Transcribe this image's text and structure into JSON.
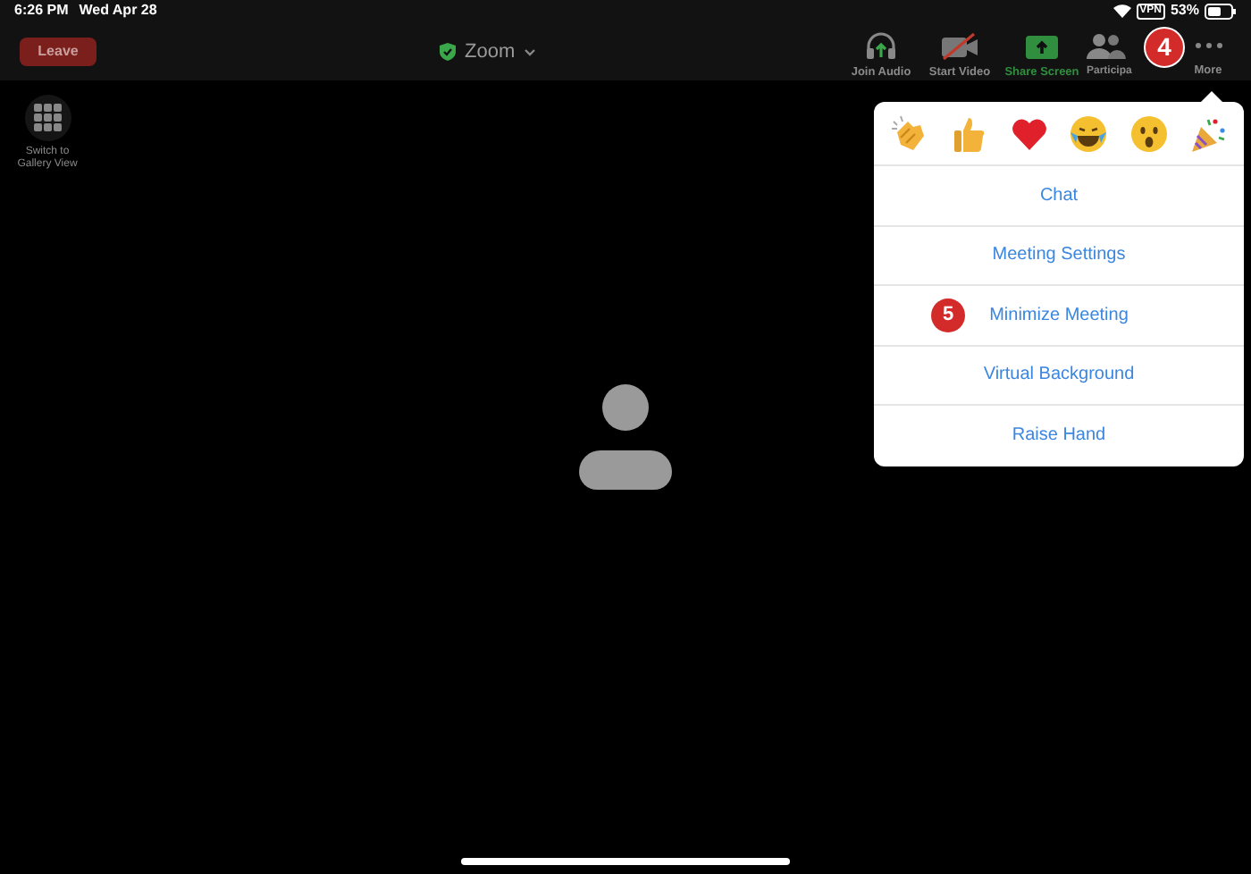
{
  "status_bar": {
    "time": "6:26 PM",
    "date": "Wed Apr 28",
    "vpn": "VPN",
    "battery": "53%"
  },
  "toolbar": {
    "leave": "Leave",
    "title": "Zoom",
    "buttons": [
      {
        "kind": "audio",
        "label": "Join Audio"
      },
      {
        "kind": "video",
        "label": "Start Video"
      },
      {
        "kind": "share",
        "label": "Share Screen"
      },
      {
        "kind": "participants",
        "label": "Participa"
      },
      {
        "kind": "more",
        "label": "More"
      }
    ]
  },
  "gallery_button": {
    "label": "Switch to Gallery View"
  },
  "toolbar_callout": "4",
  "menu": {
    "reactions": [
      {
        "kind": "clap"
      },
      {
        "kind": "thumbs"
      },
      {
        "kind": "heart"
      },
      {
        "kind": "laugh"
      },
      {
        "kind": "wow"
      },
      {
        "kind": "party"
      }
    ],
    "items": [
      {
        "label": "Chat"
      },
      {
        "label": "Meeting Settings"
      },
      {
        "label": "Minimize Meeting",
        "callout": "5"
      },
      {
        "label": "Virtual Background"
      },
      {
        "label": "Raise Hand"
      }
    ]
  }
}
